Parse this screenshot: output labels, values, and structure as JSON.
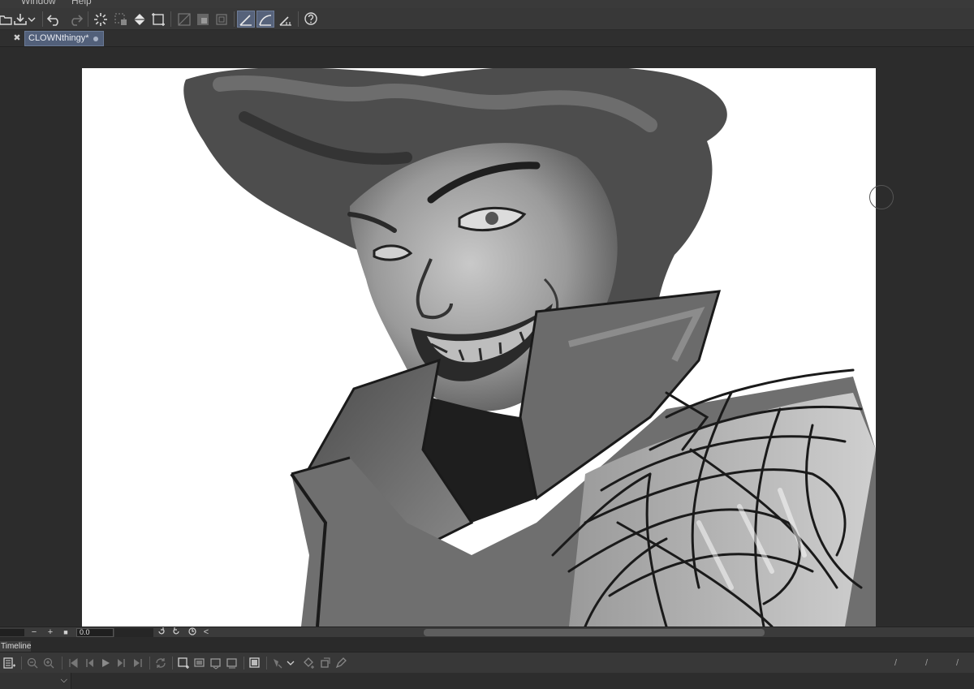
{
  "app": {
    "menu": [
      "Window",
      "Help"
    ]
  },
  "document": {
    "tab_title": "CLOWNthingy*",
    "close_glyph": "✖"
  },
  "toolbar": {
    "icons": [
      "open-file-icon",
      "save-icon",
      "dropdown-icon",
      "undo-icon",
      "redo-icon",
      "loading-icon",
      "clear-icon",
      "fill-icon",
      "transform-icon",
      "invert-selection-icon",
      "clear-outside-icon",
      "crop-icon",
      "snap-ruler-icon",
      "snap-special-ruler-icon",
      "snap-grid-icon",
      "help-icon"
    ]
  },
  "statusbar": {
    "minus": "−",
    "plus": "+",
    "stop": "■",
    "angle_value": "0.0",
    "collapse": "<"
  },
  "timeline": {
    "label": "Timeline",
    "track_chevron": "⌵",
    "tick_marks": [
      "/",
      "/",
      "/"
    ]
  }
}
